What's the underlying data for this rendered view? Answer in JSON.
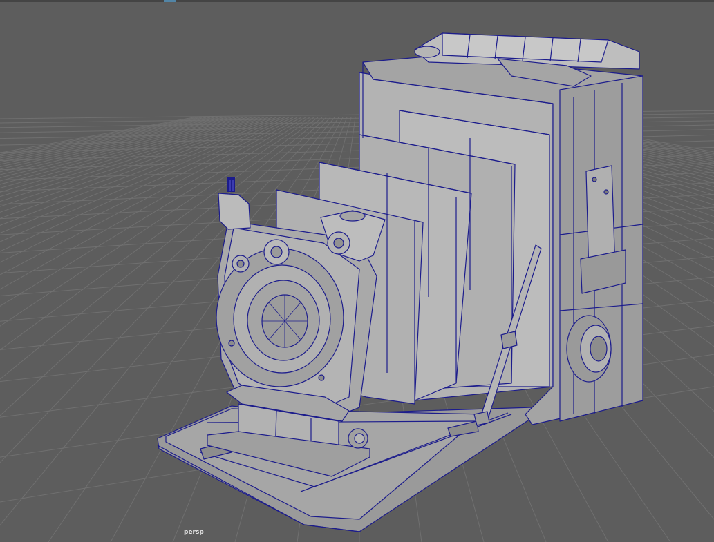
{
  "viewport": {
    "camera_label": "persp"
  },
  "colors": {
    "background": "#5d5d5d",
    "grid": "#6e6e6e",
    "wireframe": "#1c1c8c",
    "surface": "#a9a9a9",
    "surface_light": "#bdbdbd",
    "surface_dark": "#8a8a8a",
    "accent": "#5285a6"
  }
}
